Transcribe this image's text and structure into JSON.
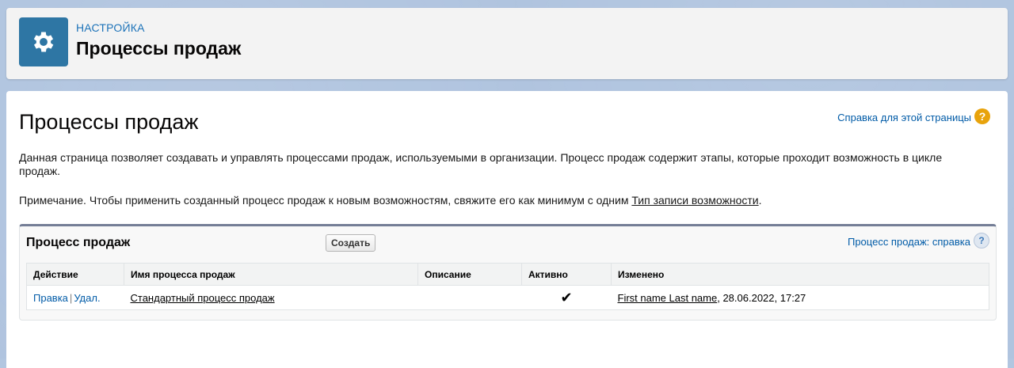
{
  "header": {
    "eyebrow": "НАСТРОЙКА",
    "title": "Процессы продаж",
    "icon": "gear-icon"
  },
  "main": {
    "title": "Процессы продаж",
    "help_link": "Справка для этой страницы",
    "description": "Данная страница позволяет создавать и управлять процессами продаж, используемыми в организации. Процесс продаж содержит этапы, которые проходит возможность в цикле продаж.",
    "note_prefix": "Примечание. Чтобы применить созданный процесс продаж к новым возможностям, свяжите его как минимум с одним ",
    "note_link": "Тип записи возможности",
    "note_suffix": "."
  },
  "panel": {
    "title": "Процесс продаж",
    "create_button": "Создать",
    "help_link": "Процесс продаж: справка",
    "columns": [
      "Действие",
      "Имя процесса продаж",
      "Описание",
      "Активно",
      "Изменено"
    ],
    "rows": [
      {
        "edit": "Правка",
        "separator": "|",
        "delete": "Удал.",
        "name": "Стандартный процесс продаж",
        "description": "",
        "active": "✔",
        "modified_by": "First name Last name",
        "modified_at": ", 28.06.2022, 17:27"
      }
    ]
  },
  "colors": {
    "accent": "#2e76a4",
    "link": "#015ba7",
    "help_badge": "#e8a30c"
  }
}
